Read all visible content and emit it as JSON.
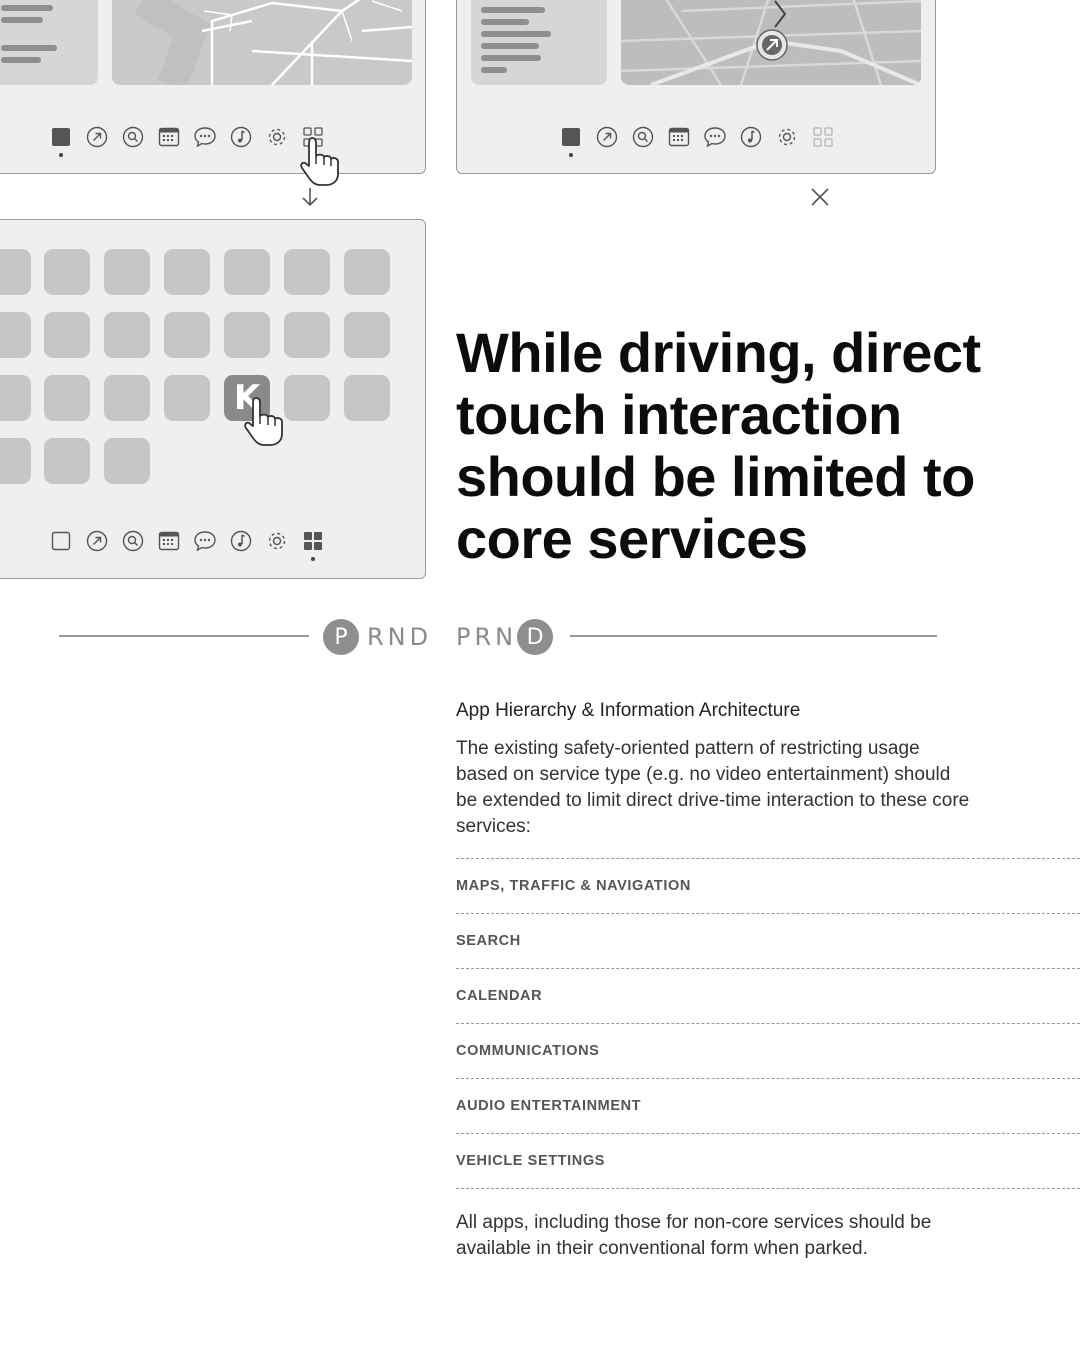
{
  "headline": "While driving, direct touch interaction should be limited to core services",
  "gear_left": {
    "active": "P",
    "rest": "RND"
  },
  "gear_right": {
    "rest": "PRN",
    "active": "D"
  },
  "grid_highlight_letter": "K",
  "section_title": "App Hierarchy & Information Architecture",
  "intro": "The existing safety-oriented pattern of restricting usage based on service type (e.g. no video entertainment) should be extended to limit direct drive-time interaction to these core services:",
  "services": [
    "MAPS, TRAFFIC & NAVIGATION",
    "SEARCH",
    "CALENDAR",
    "COMMUNICATIONS",
    "AUDIO ENTERTAINMENT",
    "VEHICLE SETTINGS"
  ],
  "closing": "All apps, including those for non-core services should be available in their conventional form when parked.",
  "dock_icons": [
    "home-icon",
    "navigation-icon",
    "search-icon",
    "calendar-icon",
    "messages-icon",
    "music-icon",
    "settings-icon",
    "apps-grid-icon"
  ],
  "colors": {
    "frame_bg": "#efefef",
    "tile": "#c6c6c6",
    "accent_gray": "#8e8e8e"
  }
}
